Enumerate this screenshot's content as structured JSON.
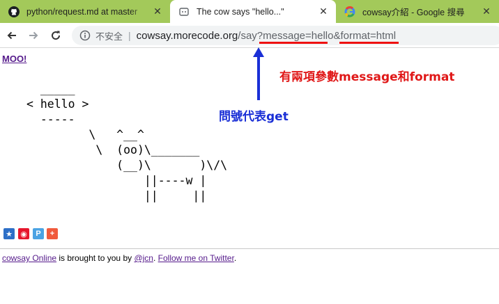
{
  "browser": {
    "tabs": [
      {
        "icon": "github-icon",
        "title": "python/request.md at master",
        "close": "✕"
      },
      {
        "icon": "cowsay-page-icon",
        "title": "The cow says \"hello...\"",
        "close": "✕"
      },
      {
        "icon": "google-icon",
        "title": "cowsay介紹 - Google 搜尋",
        "close": "✕"
      }
    ],
    "insecure_label": "不安全",
    "separator": "|",
    "url_host": "cowsay.morecode.org",
    "url_path": "/say?message=hello&format=html"
  },
  "annotations": {
    "params_text": "有兩項參數message和format",
    "get_text": "問號代表get",
    "color_red": "#e01818",
    "color_blue": "#1a2fd6"
  },
  "page": {
    "moo_link": "MOO!",
    "cow_text": "  _____\n< hello >\n  -----\n         \\   ^__^\n          \\  (oo)\\_______\n             (__)\\       )\\/\\\n                 ||----w |\n                 ||     ||",
    "share_icons": [
      "qzone-icon",
      "weibo-icon",
      "tencent-weibo-icon",
      "more-share-icon"
    ],
    "footer": {
      "link1": "cowsay Online",
      "text1": " is brought to you by ",
      "link2": "@jcn",
      "text2": ". ",
      "link3": "Follow me on Twitter",
      "text3": "."
    }
  }
}
